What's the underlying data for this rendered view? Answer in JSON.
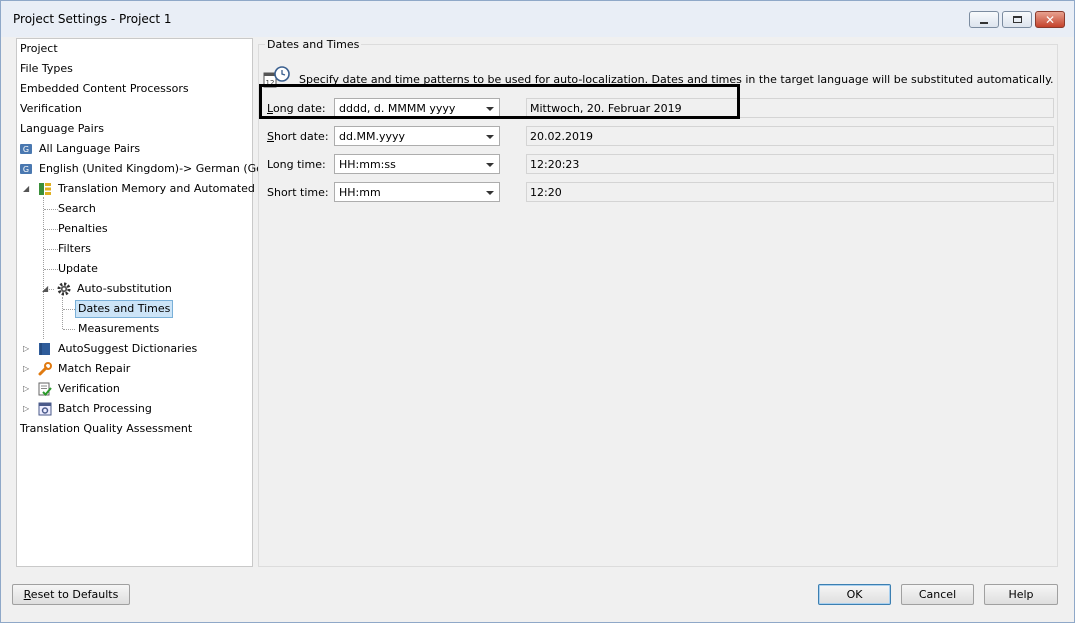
{
  "window": {
    "title": "Project Settings - Project 1"
  },
  "tree": {
    "items": [
      {
        "label": "Project"
      },
      {
        "label": "File Types"
      },
      {
        "label": "Embedded Content Processors"
      },
      {
        "label": "Verification"
      },
      {
        "label": "Language Pairs"
      },
      {
        "label": "All Language Pairs"
      },
      {
        "label": "English (United Kingdom)-> German (Ger"
      },
      {
        "label": "Translation Memory and Automated T"
      },
      {
        "label": "Search"
      },
      {
        "label": "Penalties"
      },
      {
        "label": "Filters"
      },
      {
        "label": "Update"
      },
      {
        "label": "Auto-substitution"
      },
      {
        "label": "Dates and Times"
      },
      {
        "label": "Measurements"
      },
      {
        "label": "AutoSuggest Dictionaries"
      },
      {
        "label": "Match Repair"
      },
      {
        "label": "Verification"
      },
      {
        "label": "Batch Processing"
      },
      {
        "label": "Translation Quality Assessment"
      }
    ]
  },
  "panel": {
    "title": "Dates and Times",
    "description": "Specify date and time patterns to be used for auto-localization. Dates and times in the target language will be substituted automatically.",
    "rows": [
      {
        "label_key": "L",
        "label_rest": "ong date:",
        "pattern": "dddd, d. MMMM yyyy",
        "preview": "Mittwoch, 20. Februar 2019"
      },
      {
        "label_key": "S",
        "label_rest": "hort date:",
        "pattern": "dd.MM.yyyy",
        "preview": "20.02.2019"
      },
      {
        "label_key": "",
        "label_rest": "Long time:",
        "pattern": "HH:mm:ss",
        "preview": "12:20:23"
      },
      {
        "label_key": "",
        "label_rest": "Short time:",
        "pattern": "HH:mm",
        "preview": "12:20"
      }
    ]
  },
  "footer": {
    "reset_key": "R",
    "reset_rest": "eset to Defaults",
    "ok_label": "OK",
    "cancel_label": "Cancel",
    "help_label": "Help"
  },
  "colors": {
    "title_bar": "#e9eef6",
    "selection": "#cce4f7",
    "close_button": "#c4432c"
  }
}
